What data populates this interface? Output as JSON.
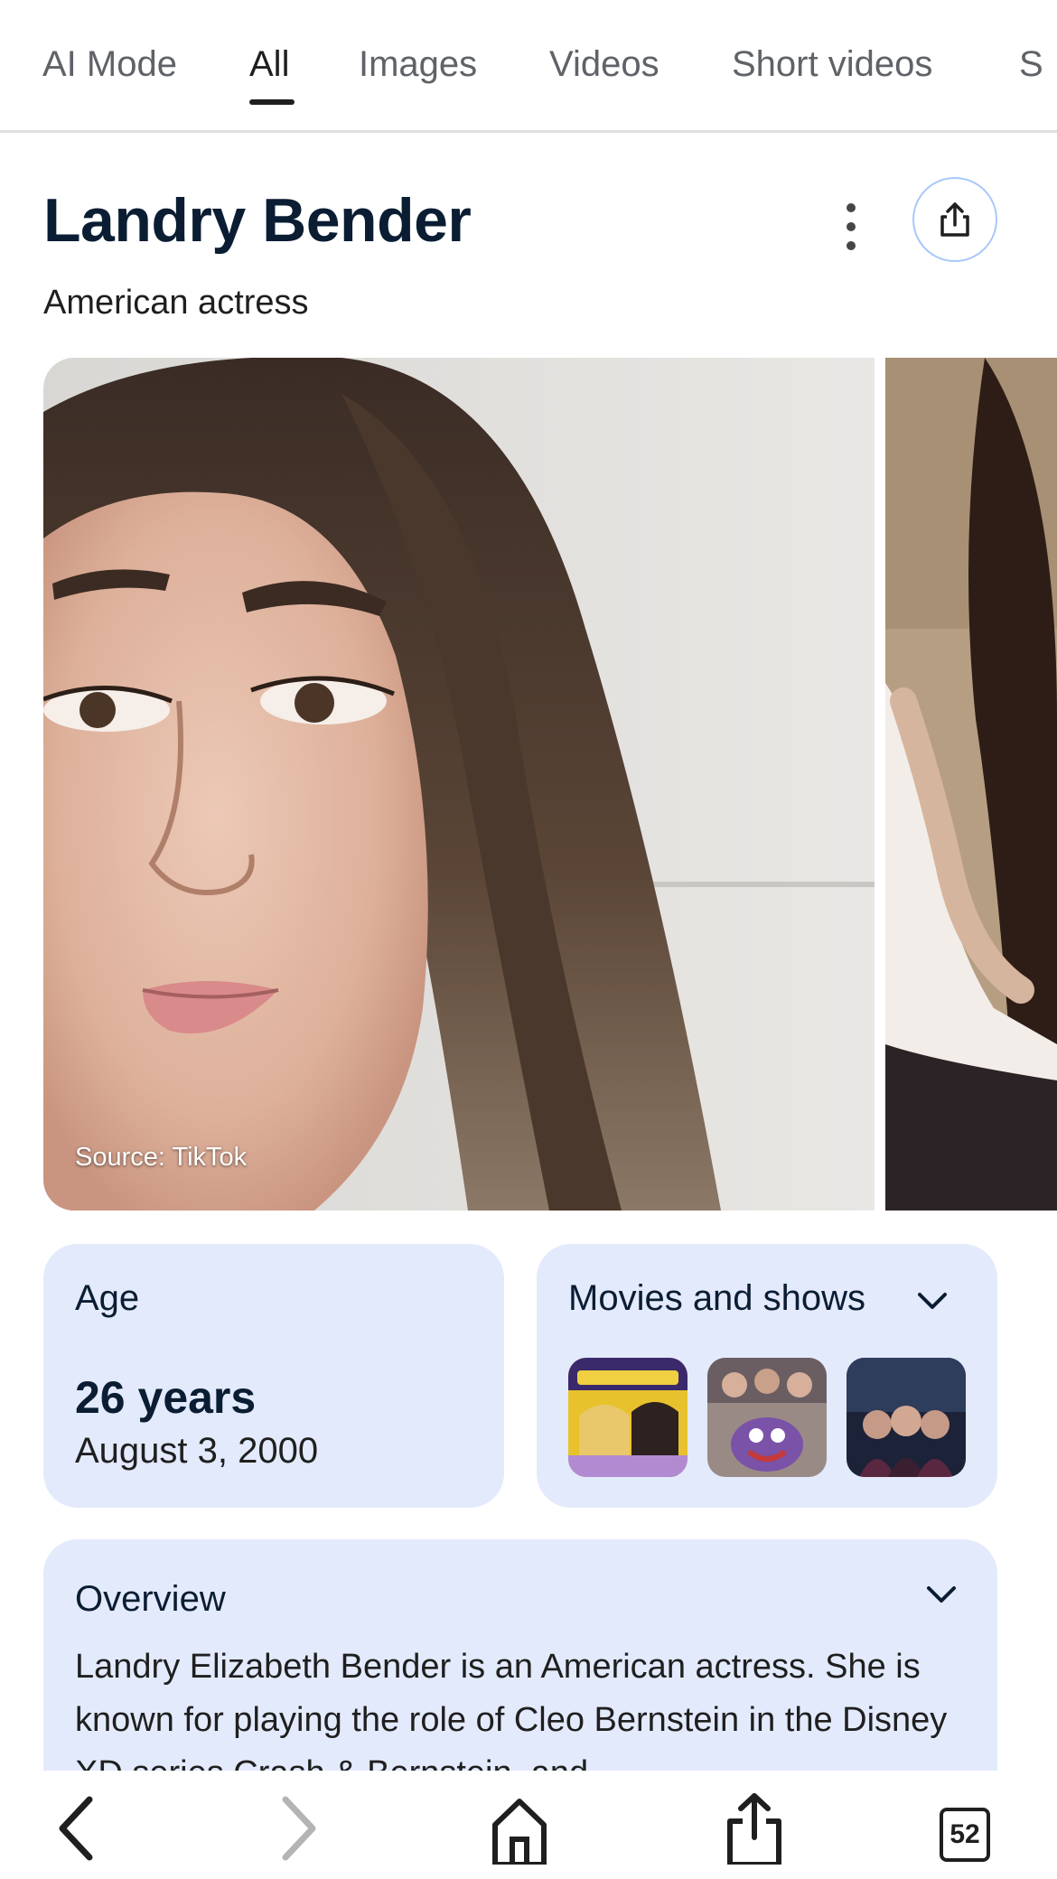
{
  "tabs": [
    {
      "label": "AI Mode",
      "active": false
    },
    {
      "label": "All",
      "active": true
    },
    {
      "label": "Images",
      "active": false
    },
    {
      "label": "Videos",
      "active": false
    },
    {
      "label": "Short videos",
      "active": false
    },
    {
      "label": "S",
      "active": false
    }
  ],
  "entity": {
    "name": "Landry Bender",
    "description": "American actress"
  },
  "images": {
    "main_source": "Source: TikTok"
  },
  "age_card": {
    "label": "Age",
    "value": "26 years",
    "birth_date": "August 3, 2000"
  },
  "movies_card": {
    "label": "Movies and shows",
    "thumbnails": [
      "movie-thumbnail-1",
      "movie-thumbnail-2",
      "movie-thumbnail-3"
    ]
  },
  "overview_card": {
    "label": "Overview",
    "text": "Landry Elizabeth Bender is an American actress. She is known for playing the role of Cleo Bernstein in the Disney XD series Crash & Bernstein, and"
  },
  "toolbar": {
    "tab_count": "52",
    "icons": [
      "back-icon",
      "forward-icon",
      "home-icon",
      "share-icon",
      "tabs-icon"
    ]
  },
  "colors": {
    "accent_border": "#a8c7fa",
    "card_bg": "#e3eafc",
    "title_text": "#0b1d33"
  }
}
